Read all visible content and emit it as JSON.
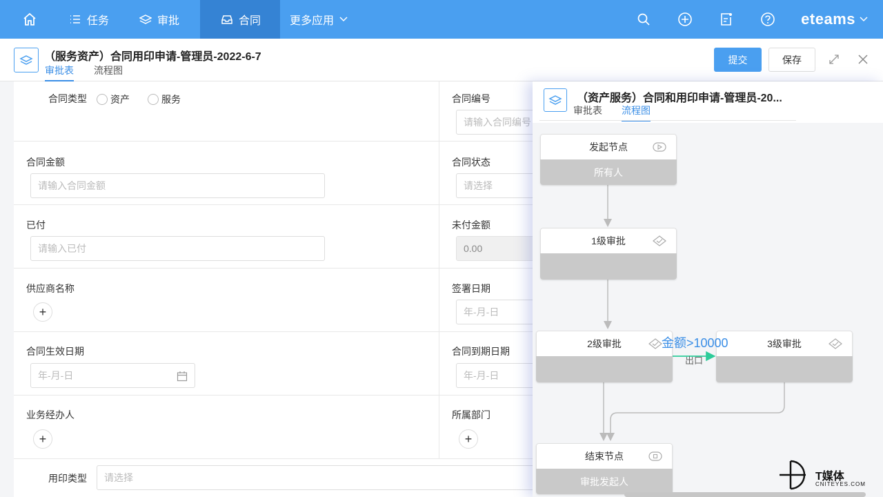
{
  "nav": {
    "items": [
      {
        "label": "任务"
      },
      {
        "label": "审批"
      },
      {
        "label": "合同"
      },
      {
        "label": "更多应用"
      }
    ],
    "brand": "eteams"
  },
  "header": {
    "title": "（服务资产）合同用印申请-管理员-2022-6-7",
    "tabs": [
      {
        "label": "审批表"
      },
      {
        "label": "流程图"
      }
    ],
    "submit_label": "提交",
    "save_label": "保存"
  },
  "form": {
    "contract_type": {
      "label": "合同类型",
      "options": [
        "资产",
        "服务"
      ]
    },
    "contract_no": {
      "label": "合同编号",
      "placeholder": "请输入合同编号"
    },
    "amount": {
      "label": "合同金额",
      "placeholder": "请输入合同金额"
    },
    "status": {
      "label": "合同状态",
      "placeholder": "请选择"
    },
    "paid": {
      "label": "已付",
      "placeholder": "请输入已付"
    },
    "unpaid": {
      "label": "未付金额",
      "value": "0.00"
    },
    "supplier": {
      "label": "供应商名称"
    },
    "sign_date": {
      "label": "签署日期",
      "placeholder": "年-月-日"
    },
    "effective_date": {
      "label": "合同生效日期",
      "placeholder": "年-月-日"
    },
    "expire_date": {
      "label": "合同到期日期",
      "placeholder": "年-月-日"
    },
    "handler": {
      "label": "业务经办人"
    },
    "department": {
      "label": "所属部门"
    },
    "seal_type": {
      "label": "用印类型",
      "placeholder": "请选择"
    }
  },
  "flow_panel": {
    "title": "（资产服务）合同和用印申请-管理员-20...",
    "tabs": [
      {
        "label": "审批表"
      },
      {
        "label": "流程图"
      }
    ],
    "nodes": {
      "start": {
        "title": "发起节点",
        "assignee": "所有人"
      },
      "level1": {
        "title": "1级审批",
        "assignee": ""
      },
      "level2": {
        "title": "2级审批",
        "assignee": ""
      },
      "level3": {
        "title": "3级审批",
        "assignee": ""
      },
      "end": {
        "title": "结束节点",
        "assignee": "审批发起人"
      }
    },
    "condition": "金额>10000",
    "exit_label": "出口"
  },
  "watermark": {
    "name": "T媒体",
    "site": "CNITEYES.COM"
  },
  "colors": {
    "primary": "#4a9ff0",
    "nav_active": "#3583d4",
    "accent": "#3a8ee6",
    "flow_arrow": "#2ecc9a"
  }
}
